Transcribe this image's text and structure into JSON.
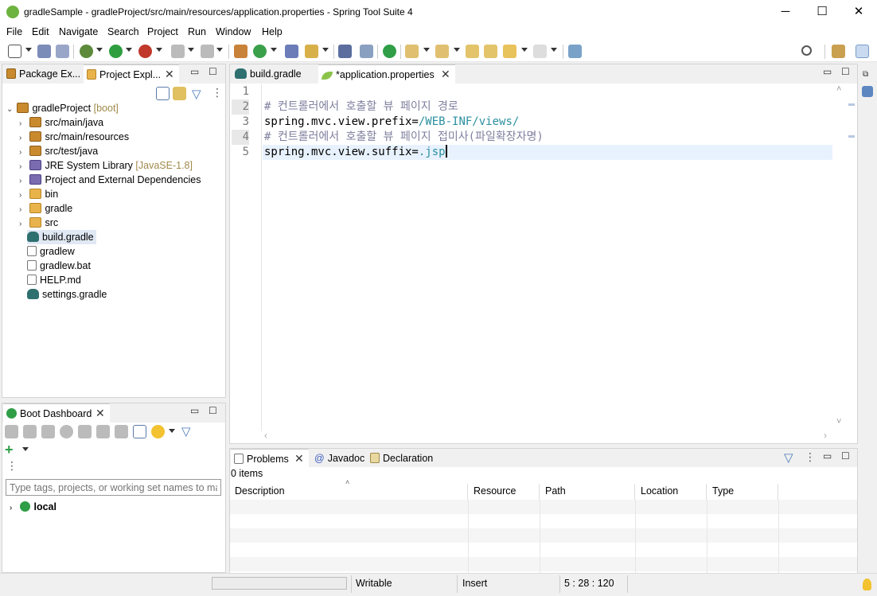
{
  "window": {
    "title": "gradleSample - gradleProject/src/main/resources/application.properties - Spring Tool Suite 4",
    "min_glyph": "─",
    "max_glyph": "☐",
    "close_glyph": "✕"
  },
  "menu": [
    "File",
    "Edit",
    "Navigate",
    "Search",
    "Project",
    "Run",
    "Window",
    "Help"
  ],
  "explorer": {
    "tabs": [
      "Package Ex...",
      "Project Expl..."
    ],
    "project": {
      "name": "gradleProject",
      "decoration": "[boot]"
    },
    "items": [
      {
        "label": "src/main/java",
        "decoration": ""
      },
      {
        "label": "src/main/resources",
        "decoration": ""
      },
      {
        "label": "src/test/java",
        "decoration": ""
      },
      {
        "label": "JRE System Library",
        "decoration": "[JavaSE-1.8]"
      },
      {
        "label": "Project and External Dependencies",
        "decoration": ""
      },
      {
        "label": "bin",
        "decoration": ""
      },
      {
        "label": "gradle",
        "decoration": ""
      },
      {
        "label": "src",
        "decoration": ""
      },
      {
        "label": "build.gradle",
        "decoration": ""
      },
      {
        "label": "gradlew",
        "decoration": ""
      },
      {
        "label": "gradlew.bat",
        "decoration": ""
      },
      {
        "label": "HELP.md",
        "decoration": ""
      },
      {
        "label": "settings.gradle",
        "decoration": ""
      }
    ]
  },
  "editor": {
    "tabs": [
      "build.gradle",
      "*application.properties"
    ],
    "line_numbers": [
      "1",
      "2",
      "3",
      "4",
      "5"
    ],
    "lines": [
      {
        "comment": "",
        "key": "",
        "value": ""
      },
      {
        "comment": "# 컨트롤러에서 호출할 뷰 페이지 경로",
        "key": "",
        "value": ""
      },
      {
        "comment": "",
        "key": "spring.mvc.view.prefix=",
        "value": "/WEB-INF/views/"
      },
      {
        "comment": "# 컨트롤러에서 호출할 뷰 페이지 접미사(파일확장자명)",
        "key": "",
        "value": ""
      },
      {
        "comment": "",
        "key": "spring.mvc.view.suffix=",
        "value": ".jsp"
      }
    ]
  },
  "boot_dashboard": {
    "title": "Boot Dashboard",
    "filter_placeholder": "Type tags, projects, or working set names to mat",
    "node": "local"
  },
  "problems": {
    "tabs": [
      "Problems",
      "Javadoc",
      "Declaration"
    ],
    "count": "0 items",
    "columns": [
      "Description",
      "Resource",
      "Path",
      "Location",
      "Type"
    ]
  },
  "status": {
    "writable": "Writable",
    "mode": "Insert",
    "position": "5 : 28 : 120"
  },
  "colors": {
    "accent": "#6db33f",
    "value_text": "#2a8fa0",
    "comment_text": "#7f7f9f",
    "current_line": "#e8f2fe"
  }
}
